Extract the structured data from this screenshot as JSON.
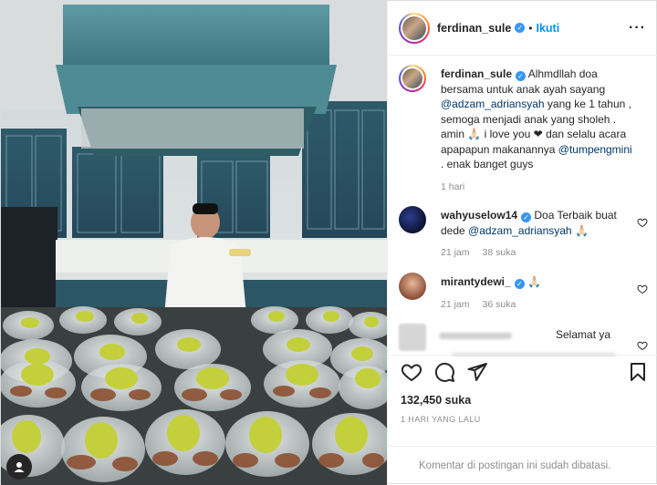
{
  "post": {
    "author": "ferdinan_sule",
    "follow_label": "Ikuti",
    "caption": {
      "username": "ferdinan_sule",
      "p1": "Alhmdllah doa bersama untuk anak ayah sayang ",
      "m1": "@adzam_adriansyah",
      "p2": " yang ke 1 tahun , semoga menjadi anak yang sholeh . amin ",
      "p2b": " i love you ",
      "p3": " dan selalu acara apapapun makanannya ",
      "m2": "@tumpengmini",
      "p4": " . enak banget guys",
      "time": "1 hari"
    },
    "comments": [
      {
        "username": "wahyuselow14",
        "text": " Doa Terbaik buat dede ",
        "mention": "@adzam_adriansyah",
        "emoji": " 🙏🏻",
        "time": "21 jam",
        "likes": "38 suka"
      },
      {
        "username": "mirantydewi_",
        "text": " 🙏🏻",
        "time": "21 jam",
        "likes": "36 suka"
      },
      {
        "text": "Selamat ya"
      }
    ],
    "likes": "132,450 suka",
    "date": "1 HARI YANG LALU",
    "comments_closed": "Komentar di postingan ini sudah dibatasi."
  },
  "colors": {
    "link": "#0095f6",
    "mention": "#00376b",
    "muted": "#8e8e8e",
    "verified": "#3897f0",
    "kitchen_teal": "#3f7f8a"
  },
  "icons": [
    "verified-badge-icon",
    "more-options-icon",
    "like-heart-icon",
    "comment-bubble-icon",
    "share-plane-icon",
    "bookmark-icon",
    "comment-like-icon",
    "profile-icon"
  ]
}
